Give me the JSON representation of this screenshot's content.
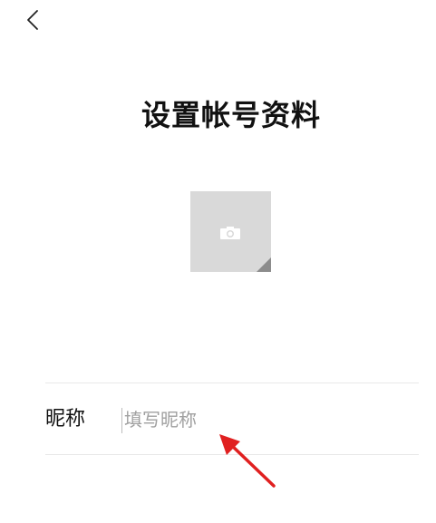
{
  "header": {
    "back_icon": "chevron-left-icon",
    "title": "设置帐号资料"
  },
  "avatar": {
    "icon": "camera-icon",
    "background_color": "#d9d9d9"
  },
  "form": {
    "nickname_label": "昵称",
    "nickname_placeholder": "填写昵称",
    "nickname_value": ""
  },
  "annotation": {
    "arrow_color": "#e02020"
  }
}
